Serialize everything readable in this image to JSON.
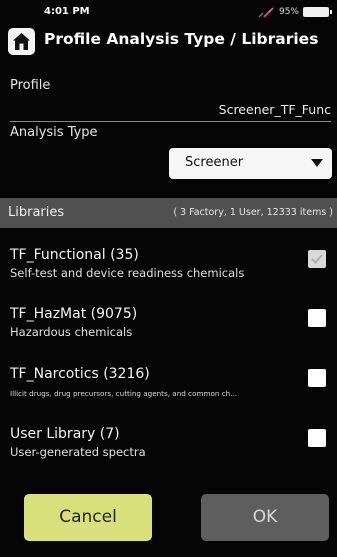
{
  "status_bar": {
    "time": "4:01 PM",
    "battery": "95%",
    "icons": [
      "signal-off-icon",
      "battery-icon"
    ]
  },
  "header": {
    "title": "Profile Analysis Type / Libraries",
    "home_icon": "home-icon"
  },
  "profile": {
    "label": "Profile",
    "value": "Screener_TF_Func"
  },
  "analysis_type": {
    "label": "Analysis Type",
    "selected": "Screener"
  },
  "libraries": {
    "title": "Libraries",
    "summary": "( 3 Factory, 1 User, 12333 items )",
    "items": [
      {
        "name": "TF_Functional (35)",
        "description": "Self-test and device readiness chemicals",
        "checked": true,
        "disabled": true
      },
      {
        "name": "TF_HazMat (9075)",
        "description": "Hazardous chemicals",
        "checked": false,
        "disabled": false
      },
      {
        "name": "TF_Narcotics (3216)",
        "description": "Illicit drugs, drug precursors, cutting agents, and common ch...",
        "checked": false,
        "disabled": false
      },
      {
        "name": "User Library (7)",
        "description": "User-generated spectra",
        "checked": false,
        "disabled": false
      }
    ]
  },
  "buttons": {
    "cancel": "Cancel",
    "ok": "OK"
  },
  "colors": {
    "cancel_bg": "#d7e07a",
    "ok_bg": "#5e5e5e",
    "library_bar": "#505050"
  }
}
